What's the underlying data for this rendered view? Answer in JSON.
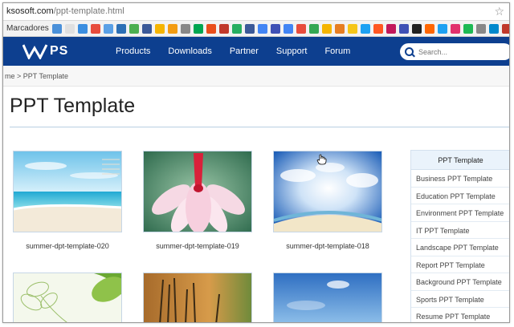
{
  "browser": {
    "url_host": "ksosoft.com",
    "url_path": "/ppt-template.html",
    "bookmarks_label": "Marcadores",
    "bookmark_icon_colors": [
      "#4a90d9",
      "#e0e0e0",
      "#3b8ee0",
      "#e74c3c",
      "#5aa0e6",
      "#2c6fb5",
      "#4caf50",
      "#3b5998",
      "#f5b400",
      "#f39c12",
      "#888888",
      "#00a651",
      "#e94e1b",
      "#c0392b",
      "#27ae60",
      "#3b5998",
      "#4285f4",
      "#3f51b5",
      "#4285f4",
      "#e74c3c",
      "#34a853",
      "#f4b400",
      "#e67e22",
      "#f5c518",
      "#1da1f2",
      "#ff5722",
      "#c2185b",
      "#3f51b5",
      "#212121",
      "#ff6600",
      "#1da1f2",
      "#e1306c",
      "#1db954",
      "#888888",
      "#0088cc",
      "#c0392b",
      "#333333",
      "#8e44ad",
      "#2ecc71"
    ]
  },
  "nav": {
    "logo_text": "PS",
    "items": [
      "Products",
      "Downloads",
      "Partner",
      "Support",
      "Forum"
    ],
    "search_placeholder": "Search..."
  },
  "breadcrumb": "me > PPT Template",
  "page_title": "PPT Template",
  "templates": [
    {
      "caption": "summer-dpt-template-020",
      "scene": "beach"
    },
    {
      "caption": "summer-dpt-template-019",
      "scene": "flower"
    },
    {
      "caption": "summer-dpt-template-018",
      "scene": "sky"
    },
    {
      "caption": "",
      "scene": "green-leaf"
    },
    {
      "caption": "",
      "scene": "grass"
    },
    {
      "caption": "",
      "scene": "blue-sky"
    }
  ],
  "sidebar": {
    "heading": "PPT Template",
    "items": [
      "Business PPT Template",
      "Education PPT Template",
      "Environment PPT Template",
      "IT PPT Template",
      "Landscape PPT Template",
      "Report PPT Template",
      "Background PPT Template",
      "Sports PPT Template",
      "Resume PPT Template"
    ]
  },
  "colors": {
    "nav_background": "#0d3f8f",
    "sidebar_heading_bg": "#eaf3fb",
    "thumb_border": "#c6d6e6"
  }
}
